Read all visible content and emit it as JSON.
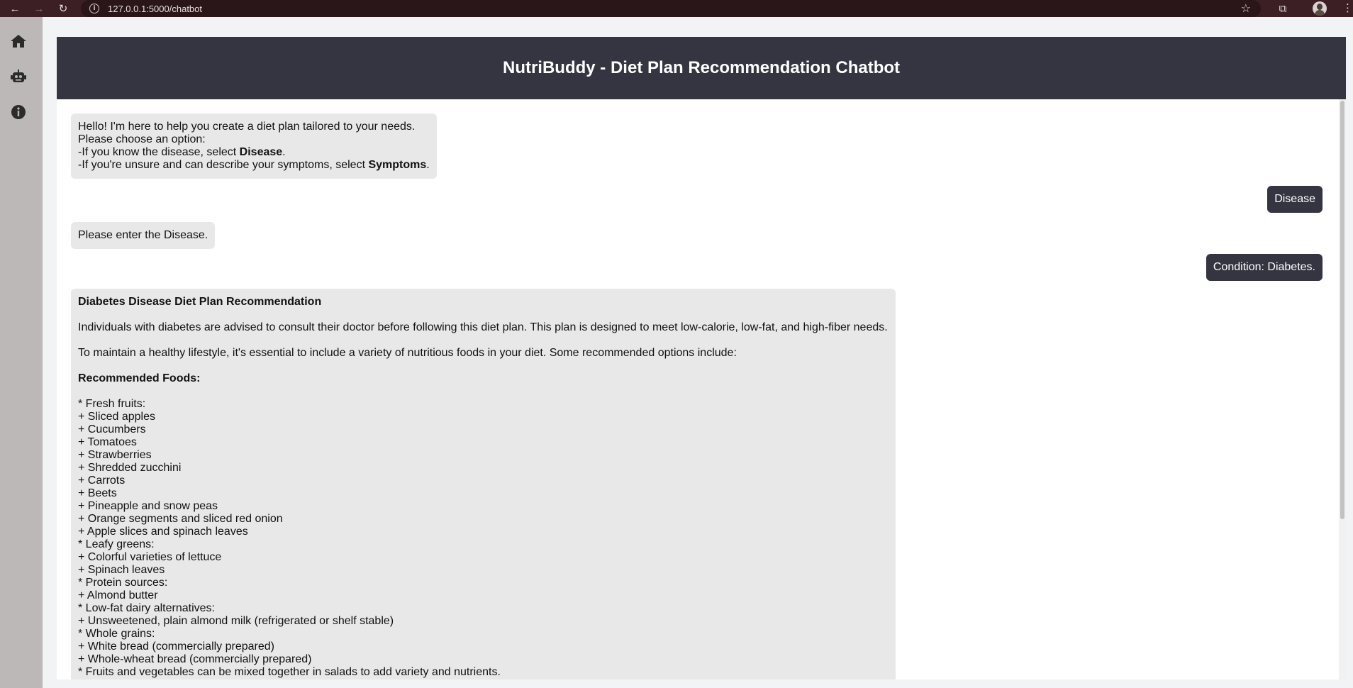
{
  "browser": {
    "url": "127.0.0.1:5000/chatbot",
    "icons": [
      "back-arrow-icon",
      "forward-arrow-icon",
      "reload-icon",
      "info-icon",
      "star-icon",
      "extensions-icon",
      "profile-avatar",
      "menu-dots-icon"
    ]
  },
  "sidebar": {
    "items": [
      {
        "name": "home",
        "icon": "home-icon"
      },
      {
        "name": "chatbot",
        "icon": "robot-icon"
      },
      {
        "name": "about",
        "icon": "info-circle-icon"
      }
    ]
  },
  "header": {
    "title": "NutriBuddy - Diet Plan Recommendation Chatbot"
  },
  "messages": {
    "greeting": {
      "line1": "Hello! I'm here to help you create a diet plan tailored to your needs.",
      "line2": "Please choose an option:",
      "line3_prefix": "-If you know the disease, select ",
      "line3_bold": "Disease",
      "line3_suffix": ".",
      "line4_prefix": "-If you're unsure and can describe your symptoms, select ",
      "line4_bold": "Symptoms",
      "line4_suffix": "."
    },
    "user_choice": "Disease",
    "ask_disease": "Please enter the Disease.",
    "user_condition": "Condition: Diabetes.",
    "plan": {
      "title": "Diabetes Disease Diet Plan Recommendation",
      "intro": "Individuals with diabetes are advised to consult their doctor before following this diet plan. This plan is designed to meet low-calorie, low-fat, and high-fiber needs.",
      "maintain": "To maintain a healthy lifestyle, it's essential to include a variety of nutritious foods in your diet. Some recommended options include:",
      "recommended_heading": "Recommended Foods:",
      "items": [
        "* Fresh fruits:",
        "+ Sliced apples",
        "+ Cucumbers",
        "+ Tomatoes",
        "+ Strawberries",
        "+ Shredded zucchini",
        "+ Carrots",
        "+ Beets",
        "+ Pineapple and snow peas",
        "+ Orange segments and sliced red onion",
        "+ Apple slices and spinach leaves",
        "* Leafy greens:",
        "+ Colorful varieties of lettuce",
        "+ Spinach leaves",
        "* Protein sources:",
        "+ Almond butter",
        "* Low-fat dairy alternatives:",
        "+ Unsweetened, plain almond milk (refrigerated or shelf stable)",
        "* Whole grains:",
        "+ White bread (commercially prepared)",
        "+ Whole-wheat bread (commercially prepared)",
        "* Fruits and vegetables can be mixed together in salads to add variety and nutrients."
      ]
    }
  }
}
